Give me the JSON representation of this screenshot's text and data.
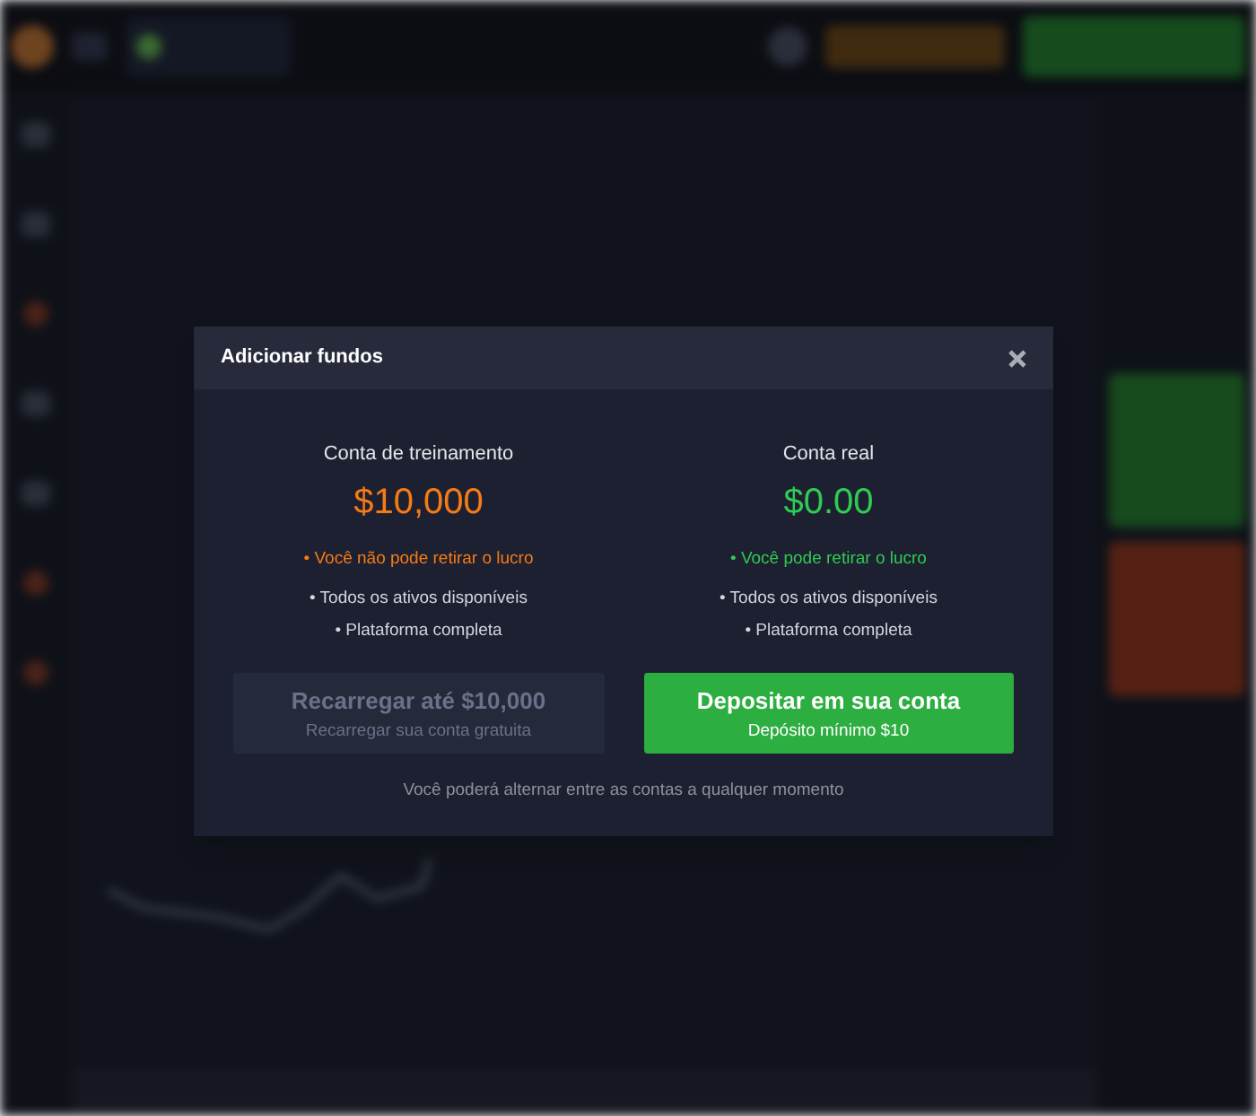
{
  "dialog": {
    "title": "Adicionar fundos"
  },
  "accounts": [
    {
      "name": "Conta de treinamento",
      "balance": "$10,000",
      "color": "#f57b17",
      "features": [
        {
          "text": "• Você não pode retirar o lucro",
          "highlight": true
        },
        {
          "text": "• Todos os ativos disponíveis",
          "highlight": false
        },
        {
          "text": "• Plataforma completa",
          "highlight": false
        }
      ],
      "button": {
        "label": "Recarregar até $10,000",
        "sublabel": "Recarregar sua conta gratuita",
        "disabled": true
      }
    },
    {
      "name": "Conta real",
      "balance": "$0.00",
      "color": "#2fcb53",
      "features": [
        {
          "text": "• Você pode retirar o lucro",
          "highlight": true
        },
        {
          "text": "• Todos os ativos disponíveis",
          "highlight": false
        },
        {
          "text": "• Plataforma completa",
          "highlight": false
        }
      ],
      "button": {
        "label": "Depositar em sua conta",
        "sublabel": "Depósito mínimo $10",
        "disabled": false
      }
    }
  ],
  "note": "Você poderá alternar entre as contas a qualquer momento"
}
